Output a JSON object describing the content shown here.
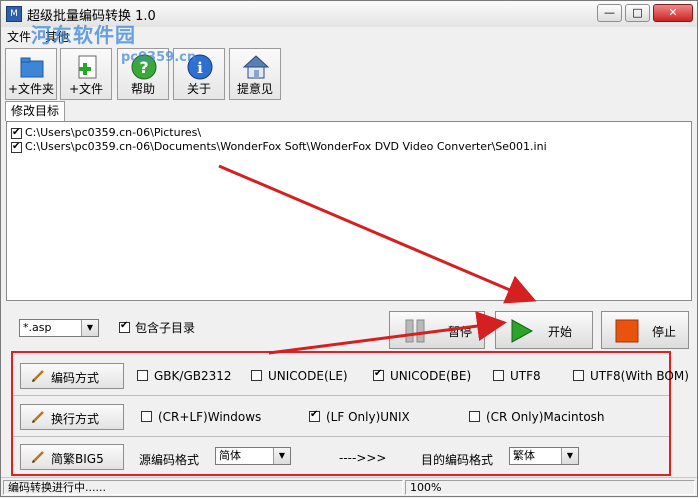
{
  "window": {
    "title": "超级批量编码转换 1.0",
    "minimize_glyph": "—",
    "maximize_glyph": "□",
    "close_glyph": "✕"
  },
  "menu": {
    "file": "文件",
    "other": "其他"
  },
  "watermark": {
    "text": "河东软件园",
    "url": "pc0359.cn"
  },
  "toolbar": {
    "folder": {
      "label": "+文件夹",
      "icon": "folder-add-icon"
    },
    "file": {
      "label": "+文件",
      "icon": "file-add-icon"
    },
    "help": {
      "label": "帮助",
      "icon": "help-icon"
    },
    "about": {
      "label": "关于",
      "icon": "info-icon"
    },
    "feedback": {
      "label": "提意见",
      "icon": "house-icon"
    }
  },
  "tabs": {
    "active": "修改目标"
  },
  "file_list": [
    {
      "checked": true,
      "path": "C:\\Users\\pc0359.cn-06\\Pictures\\"
    },
    {
      "checked": true,
      "path": "C:\\Users\\pc0359.cn-06\\Documents\\WonderFox Soft\\WonderFox DVD Video Converter\\Se001.ini"
    }
  ],
  "filter": {
    "value": "*.asp",
    "include_subdirs_label": "包含子目录",
    "include_subdirs_checked": true
  },
  "actions": {
    "pause": "暂停",
    "start": "开始",
    "stop": "停止"
  },
  "encoding": {
    "button": "编码方式",
    "options": [
      {
        "label": "GBK/GB2312",
        "checked": false
      },
      {
        "label": "UNICODE(LE)",
        "checked": false
      },
      {
        "label": "UNICODE(BE)",
        "checked": true
      },
      {
        "label": "UTF8",
        "checked": false
      },
      {
        "label": "UTF8(With BOM)",
        "checked": false
      }
    ]
  },
  "line_ending": {
    "button": "换行方式",
    "options": [
      {
        "label": "(CR+LF)Windows",
        "checked": false
      },
      {
        "label": "(LF Only)UNIX",
        "checked": true
      },
      {
        "label": "(CR Only)Macintosh",
        "checked": false
      }
    ]
  },
  "big5": {
    "button": "简繁BIG5",
    "source_label": "源编码格式",
    "source_value": "简体",
    "arrow_text": "---->>>",
    "target_label": "目的编码格式",
    "target_value": "繁体"
  },
  "status": {
    "message": "编码转换进行中......",
    "progress": "100%"
  },
  "colors": {
    "highlight_border": "#d22222",
    "arrow": "#d42020",
    "start_green": "#2aa52a",
    "stop_orange": "#e8530e"
  }
}
